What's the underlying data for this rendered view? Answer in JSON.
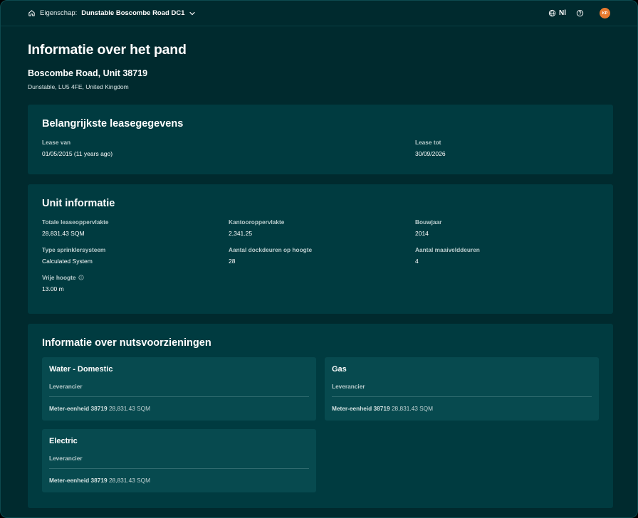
{
  "topbar": {
    "property_label": "Eigenschap:",
    "property_name": "Dunstable Boscombe Road DC1",
    "language": "Nl",
    "avatar_initials": "KP"
  },
  "page": {
    "title": "Informatie over het pand",
    "address_line1": "Boscombe Road, Unit 38719",
    "address_line2": "Dunstable, LU5 4FE, United Kingdom"
  },
  "lease": {
    "title": "Belangrijkste leasegegevens",
    "fields": [
      {
        "label": "Lease van",
        "value": "01/05/2015 (11 years ago)"
      },
      {
        "label": "Lease tot",
        "value": "30/09/2026"
      }
    ]
  },
  "unit": {
    "title": "Unit informatie",
    "fields": [
      {
        "label": "Totale leaseoppervlakte",
        "value": "28,831.43 SQM"
      },
      {
        "label": "Kantooroppervlakte",
        "value": "2,341.25"
      },
      {
        "label": "Bouwjaar",
        "value": "2014"
      },
      {
        "label": "Type sprinklersysteem",
        "value": "Calculated System"
      },
      {
        "label": "Aantal dockdeuren op hoogte",
        "value": "28"
      },
      {
        "label": "Aantal maaivelddeuren",
        "value": "4"
      },
      {
        "label": "Vrije hoogte",
        "value": "13.00 m"
      }
    ]
  },
  "utilities": {
    "title": "Informatie over nutsvoorzieningen",
    "items": [
      {
        "name": "Water - Domestic",
        "supplier_label": "Leverancier",
        "meter_label": "Meter-eenheid 38719",
        "meter_value": "28,831.43 SQM"
      },
      {
        "name": "Gas",
        "supplier_label": "Leverancier",
        "meter_label": "Meter-eenheid 38719",
        "meter_value": "28,831.43 SQM"
      },
      {
        "name": "Electric",
        "supplier_label": "Leverancier",
        "meter_label": "Meter-eenheid 38719",
        "meter_value": "28,831.43 SQM"
      }
    ]
  },
  "colors": {
    "background": "#002a2e",
    "card": "#003b40",
    "subcard": "#074a4f",
    "avatar": "#e87a2e"
  }
}
